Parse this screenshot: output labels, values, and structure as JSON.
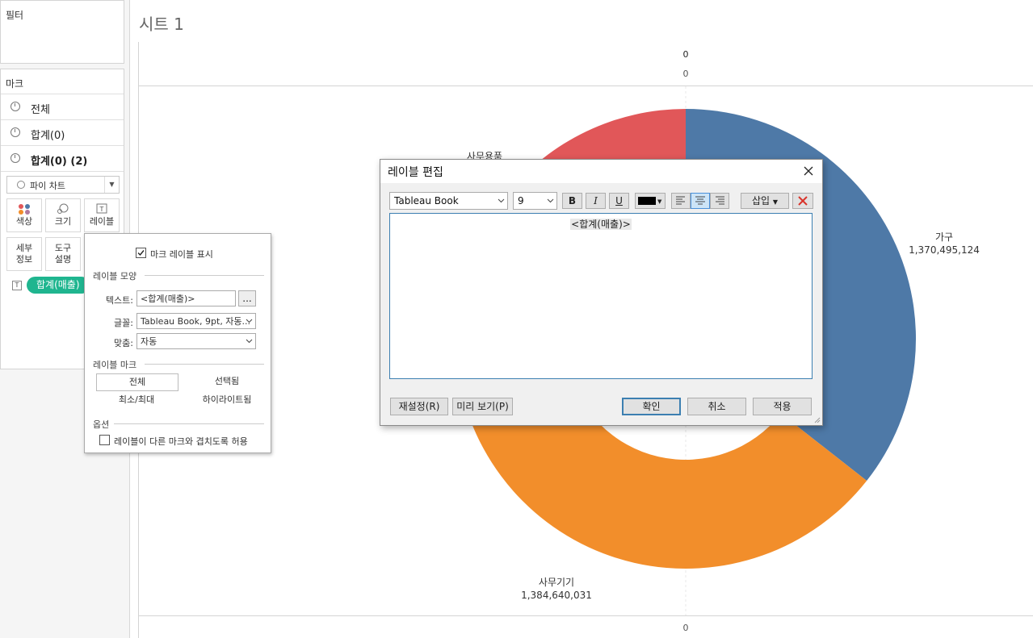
{
  "filters": {
    "title": "필터"
  },
  "marks": {
    "title": "마크",
    "rows": [
      {
        "label": "전체"
      },
      {
        "label": "합계(0)"
      },
      {
        "label": "합계(0) (2)"
      }
    ],
    "mark_type": "파이 차트",
    "buttons": [
      {
        "label": "색상",
        "icon": "color-dots-icon"
      },
      {
        "label": "크기",
        "icon": "size-icon"
      },
      {
        "label": "레이블",
        "icon": "text-icon"
      },
      {
        "label": "세부\n정보",
        "icon": ""
      },
      {
        "label": "도구\n설명",
        "icon": ""
      }
    ],
    "pill": "합계(매출)"
  },
  "sheet": {
    "title": "시트 1",
    "axis_top_header": "0",
    "axis_top_tick": "0",
    "axis_bottom_tick": "0"
  },
  "chart_data": {
    "type": "pie",
    "donut": true,
    "slices": [
      {
        "name": "가구",
        "value": 1370495124,
        "label_value": "1,370,495,124",
        "color": "#4e79a7"
      },
      {
        "name": "사무기기",
        "value": 1384640031,
        "label_value": "1,384,640,031",
        "color": "#f28e2b"
      },
      {
        "name": "사무용품",
        "value": 1095000000,
        "color": "#e15759"
      }
    ],
    "visible_labels": [
      {
        "name": "가구",
        "value": "1,370,495,124"
      },
      {
        "name": "사무기기",
        "value": "1,384,640,031"
      },
      {
        "name": "사무용품"
      }
    ]
  },
  "label_popup": {
    "show_labels": "마크 레이블 표시",
    "section_appearance": "레이블 모양",
    "text_label": "텍스트:",
    "text_value": "<합계(매출)>",
    "more_button": "...",
    "font_label": "글꼴:",
    "font_value": "Tableau Book, 9pt, 자동...",
    "align_label": "맞춤:",
    "align_value": "자동",
    "section_marks": "레이블 마크",
    "marks_options": [
      "전체",
      "선택됨",
      "최소/최대",
      "하이라이트됨"
    ],
    "section_options": "옵션",
    "allow_overlap": "레이블이 다른 마크와 겹치도록 허용"
  },
  "dialog": {
    "title": "레이블 편집",
    "font_family": "Tableau Book",
    "font_size": "9",
    "bold": "B",
    "italic": "I",
    "underline": "U",
    "insert": "삽입",
    "content": "<합계(매출)>",
    "reset": "재설정(R)",
    "preview": "미리 보기(P)",
    "ok": "확인",
    "cancel": "취소",
    "apply": "적용"
  }
}
